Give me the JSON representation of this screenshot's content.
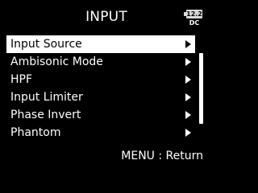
{
  "header": {
    "title": "INPUT",
    "battery": {
      "voltage": "12.2",
      "source": "DC"
    }
  },
  "menu": {
    "items": [
      {
        "label": "Input Source",
        "selected": true
      },
      {
        "label": "Ambisonic Mode",
        "selected": false
      },
      {
        "label": "HPF",
        "selected": false
      },
      {
        "label": "Input Limiter",
        "selected": false
      },
      {
        "label": "Phase Invert",
        "selected": false
      },
      {
        "label": "Phantom",
        "selected": false
      }
    ]
  },
  "footer": {
    "hint": "MENU : Return"
  },
  "colors": {
    "background": "#000000",
    "text": "#ffffff",
    "selected_background": "#ffffff",
    "selected_text": "#000000",
    "battery_badge": "#d9d9d9"
  },
  "icons": {
    "submenu": "triangle-right-icon",
    "battery": "battery-icon"
  }
}
